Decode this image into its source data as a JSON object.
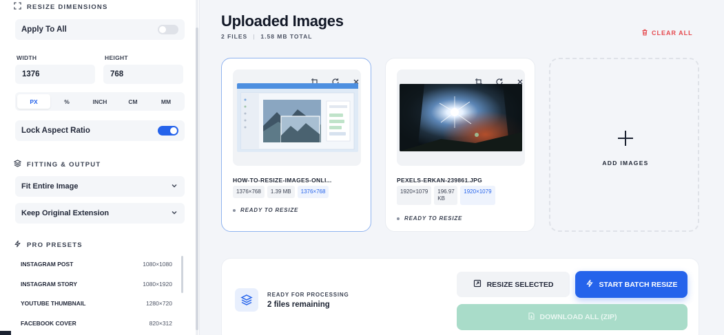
{
  "sidebar": {
    "resize_section": {
      "title": "RESIZE DIMENSIONS",
      "icon": "expand-icon"
    },
    "apply_to_all": {
      "label": "Apply To All",
      "enabled": false
    },
    "width": {
      "label": "WIDTH",
      "value": "1376"
    },
    "height": {
      "label": "HEIGHT",
      "value": "768"
    },
    "units": [
      "PX",
      "%",
      "INCH",
      "CM",
      "MM"
    ],
    "active_unit": "PX",
    "lock_aspect": {
      "label": "Lock Aspect Ratio",
      "enabled": true
    },
    "fitting_section": {
      "title": "FITTING & OUTPUT",
      "icon": "layers-icon"
    },
    "fit_select": "Fit Entire Image",
    "ext_select": "Keep Original Extension",
    "presets_section": {
      "title": "PRO PRESETS",
      "icon": "sparkle-icon"
    },
    "presets": [
      {
        "name": "INSTAGRAM POST",
        "size": "1080×1080"
      },
      {
        "name": "INSTAGRAM STORY",
        "size": "1080×1920"
      },
      {
        "name": "YOUTUBE THUMBNAIL",
        "size": "1280×720"
      },
      {
        "name": "FACEBOOK COVER",
        "size": "820×312"
      }
    ]
  },
  "main": {
    "title": "Uploaded Images",
    "files_count": "2 FILES",
    "total_size": "1.58 MB TOTAL",
    "clear_all": "CLEAR ALL",
    "images": [
      {
        "filename": "HOW-TO-RESIZE-IMAGES-ONLI...",
        "dims": "1376×768",
        "size": "1.39 MB",
        "target": "1376×768",
        "status": "READY TO RESIZE",
        "selected": true
      },
      {
        "filename": "PEXELS-ERKAN-239861.JPG",
        "dims": "1920×1079",
        "size": "196.97 KB",
        "target": "1920×1079",
        "status": "READY TO RESIZE",
        "selected": false
      }
    ],
    "add_images": "ADD IMAGES"
  },
  "bottom": {
    "title": "READY FOR PROCESSING",
    "remaining": "2 files remaining",
    "resize_selected": "RESIZE SELECTED",
    "start_batch": "START BATCH RESIZE",
    "download_all": "DOWNLOAD ALL (ZIP)"
  },
  "colors": {
    "accent": "#2563eb",
    "danger": "#e5484d",
    "download_disabled": "#a9dcc9"
  }
}
